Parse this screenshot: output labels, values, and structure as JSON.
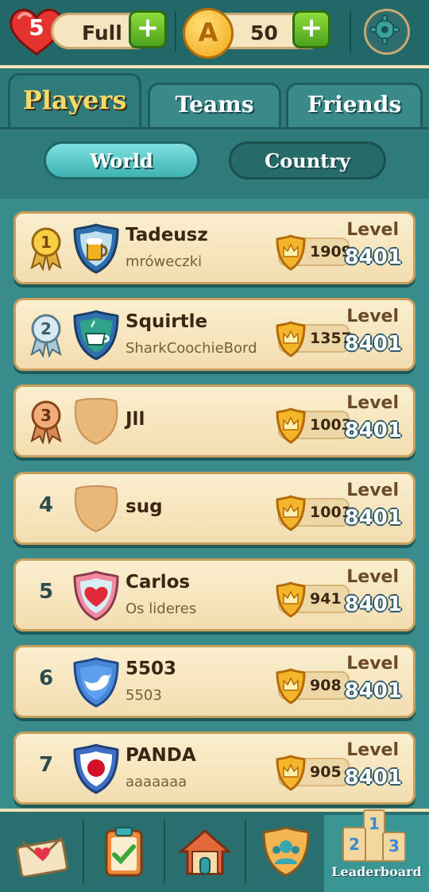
{
  "topbar": {
    "lives_count": "5",
    "lives_status": "Full",
    "coins_icon_letter": "A",
    "coins": "50",
    "plus_label": "+"
  },
  "tabs": [
    {
      "label": "Players",
      "active": true
    },
    {
      "label": "Teams",
      "active": false
    },
    {
      "label": "Friends",
      "active": false
    }
  ],
  "scope": [
    {
      "label": "World",
      "active": true
    },
    {
      "label": "Country",
      "active": false
    }
  ],
  "level_label": "Level",
  "players": [
    {
      "rank": "1",
      "name": "Tadeusz",
      "team": "mróweczki",
      "crowns": "1909",
      "level": "8401",
      "medal": "gold",
      "avatar": "beer-mug-shield-icon"
    },
    {
      "rank": "2",
      "name": "Squirtle",
      "team": "SharkCoochieBord",
      "crowns": "1357",
      "level": "8401",
      "medal": "silver",
      "avatar": "coffee-cup-shield-icon"
    },
    {
      "rank": "3",
      "name": "Jll",
      "team": "",
      "crowns": "1003",
      "level": "8401",
      "medal": "bronze",
      "avatar": "blank-avatar-icon"
    },
    {
      "rank": "4",
      "name": "sug",
      "team": "",
      "crowns": "1001",
      "level": "8401",
      "medal": "none",
      "avatar": "blank-avatar-icon"
    },
    {
      "rank": "5",
      "name": "Carlos",
      "team": "Os lideres",
      "crowns": "941",
      "level": "8401",
      "medal": "none",
      "avatar": "heart-shield-icon"
    },
    {
      "rank": "6",
      "name": "5503",
      "team": "5503",
      "crowns": "908",
      "level": "8401",
      "medal": "none",
      "avatar": "bird-shield-icon"
    },
    {
      "rank": "7",
      "name": "PANDA",
      "team": "aaaaaaa",
      "crowns": "905",
      "level": "8401",
      "medal": "none",
      "avatar": "red-sun-shield-icon"
    }
  ],
  "bottom_nav": {
    "items": [
      "inbox-icon",
      "tasks-icon",
      "home-icon",
      "team-icon",
      "leaderboard-icon"
    ],
    "active_label": "Leaderboard",
    "podium_numbers": [
      "1",
      "2",
      "3"
    ]
  },
  "colors": {
    "background": "#2c7a7a",
    "row_bg": "#fbefcf",
    "active_tab_text": "#f7d96a",
    "accent_green": "#4aa21e"
  }
}
